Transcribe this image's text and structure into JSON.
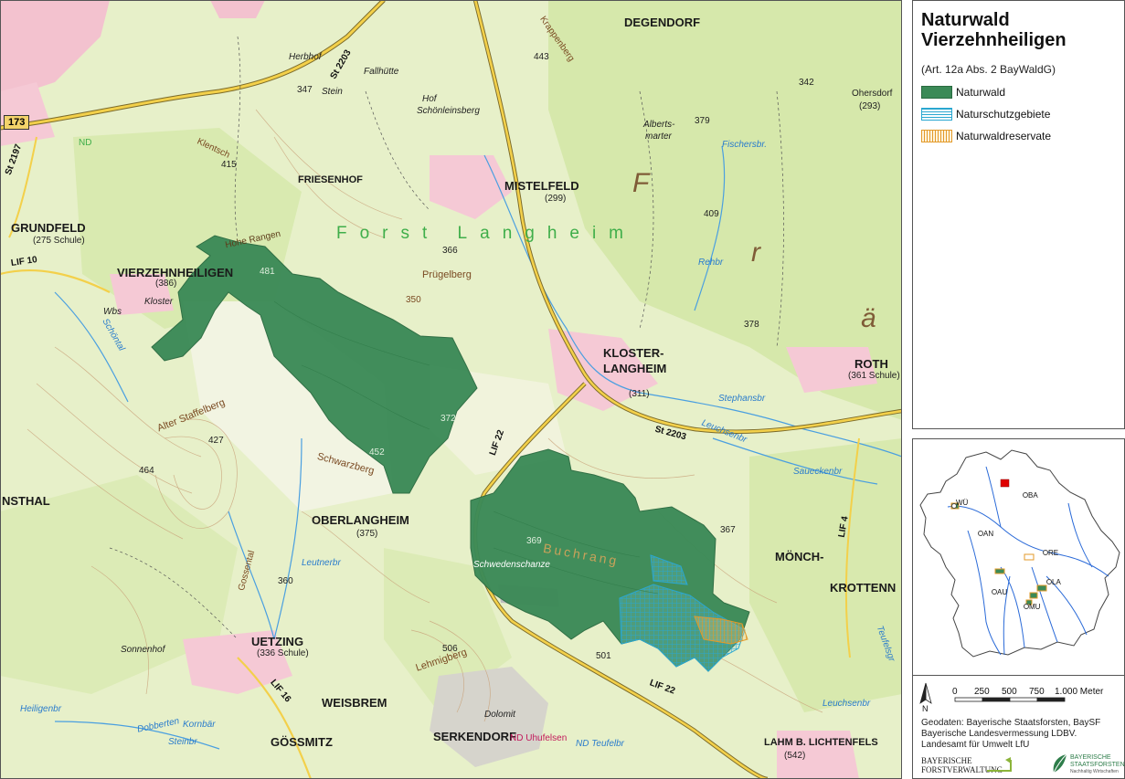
{
  "legend": {
    "title_line1": "Naturwald",
    "title_line2": "Vierzehnheiligen",
    "subtitle": "(Art. 12a Abs. 2 BayWaldG)",
    "items": [
      {
        "label": "Naturwald",
        "color": "#3b8a57",
        "icon": "solid-green-swatch"
      },
      {
        "label": "Naturschutzgebiete",
        "color": "#2aa7d0",
        "icon": "blue-hatched-swatch"
      },
      {
        "label": "Naturwaldreservate",
        "color": "#e39a2a",
        "icon": "orange-hatched-swatch"
      }
    ]
  },
  "inset": {
    "cities": [
      "BA",
      "WÜ",
      "AN",
      "RE",
      "LA",
      "AU",
      "MU"
    ],
    "highlight_color": "#e00000"
  },
  "scale": {
    "ticks": [
      "0",
      "250",
      "500",
      "750",
      "1.000 Meter"
    ],
    "north": "N"
  },
  "credits": {
    "line1": "Geodaten: Bayerische Staatsforsten, BaySF",
    "line2": "Bayerische Landesvermessung LDBV.",
    "line3": "Landesamt für Umwelt LfU"
  },
  "logos": {
    "left_line1": "BAYERISCHE",
    "left_line2": "FORSTVERWALTUNG",
    "right_line1": "BAYERISCHE",
    "right_line2": "STAATSFORSTEN",
    "right_line3": "Nachhaltig Wirtschaften"
  },
  "map": {
    "places": {
      "degendorf": "DEGENDORF",
      "grundfeld": "GRUNDFELD",
      "grundfeld_sub": "(275 Schule)",
      "vierzehnheiligen": "VIERZEHNHEILIGEN",
      "vierzehnheiligen_sub": "(386)",
      "friesenhof": "FRIESENHOF",
      "mistelfeld": "MISTELFELD",
      "mistelfeld_sub": "(299)",
      "kloster": "KLOSTER-",
      "langheim": "LANGHEIM",
      "langheim_sub": "(311)",
      "roth": "ROTH",
      "roth_sub": "(361 Schule)",
      "oberlangheim": "OBERLANGHEIM",
      "oberlangheim_sub": "(375)",
      "moench": "MÖNCH-",
      "krottenn": "KROTTENN",
      "uetzing": "UETZING",
      "uetzing_sub": "(336 Schule)",
      "weisbrem": "WEISBREM",
      "goessmitz": "GÖSSMITZ",
      "serkendorf": "SERKENDORF",
      "lahm": "LAHM B. LICHTENFELS",
      "lahm_sub": "(542)",
      "nsthal": "NSTHAL",
      "ohersdor": "Ohersdorf",
      "ohersdor_sub": "(293)"
    },
    "forest_label": "Forst   Langheim",
    "big_letters": [
      "F",
      "r",
      "ä"
    ],
    "small_labels": {
      "krappenberg": "Krappenberg",
      "herbhof": "Herbhof",
      "stein": "Stein",
      "fallhuette": "Fallhütte",
      "hof_schoen": "Hof",
      "schoenleinsberg": "Schönleinsberg",
      "alberts": "Alberts-",
      "marter": "marter",
      "fischersbr": "Fischersbr.",
      "kloster_small": "Kloster",
      "wbs": "Wbs",
      "kientsch": "Klentsch",
      "rehbr": "Rehbr",
      "pruegelberg": "Prügelberg",
      "hohe_rangen": "Hohe Rangen",
      "alter_staffelberg": "Alter Staffelberg",
      "schwarzberg": "Schwarzberg",
      "buchrang": "Buchrang",
      "schwedenschanze": "Schwedenschanze",
      "stephansbr": "Stephansbr",
      "sonnenhof": "Sonnenhof",
      "lehmigberg": "Lehmigberg",
      "dolomit": "Dolomit",
      "nd_uhufelsen": "ND Uhufelsen",
      "nd_teufel": "ND Teufelbr",
      "saueckenbr": "Saueckenbr",
      "leuchsenbr": "Leuchsenbr",
      "leuchsenbr2": "Leuchsenbr",
      "gossental": "Gossental",
      "leutnerbr": "Leutnerbr",
      "heiligenbr": "Heiligenbr",
      "dobberten": "Dobberten",
      "kornbaer": "Kornbär",
      "steinbr": "Steinbr",
      "nd": "ND",
      "schoental": "Schöntal",
      "teufelsgr": "Teufelsgr"
    },
    "heights": [
      "443",
      "347",
      "415",
      "342",
      "379",
      "409",
      "366",
      "378",
      "481",
      "350",
      "372",
      "452",
      "427",
      "464",
      "369",
      "367",
      "360",
      "506",
      "501"
    ],
    "roads": {
      "b173": "173",
      "st2203_a": "St 2203",
      "st2203_b": "St 2203",
      "st2197": "St 2197",
      "lif10": "LIF 10",
      "lif22_a": "LIF 22",
      "lif22_b": "LIF 22",
      "lif16": "LIF 16",
      "lif4": "LIF 4"
    }
  }
}
